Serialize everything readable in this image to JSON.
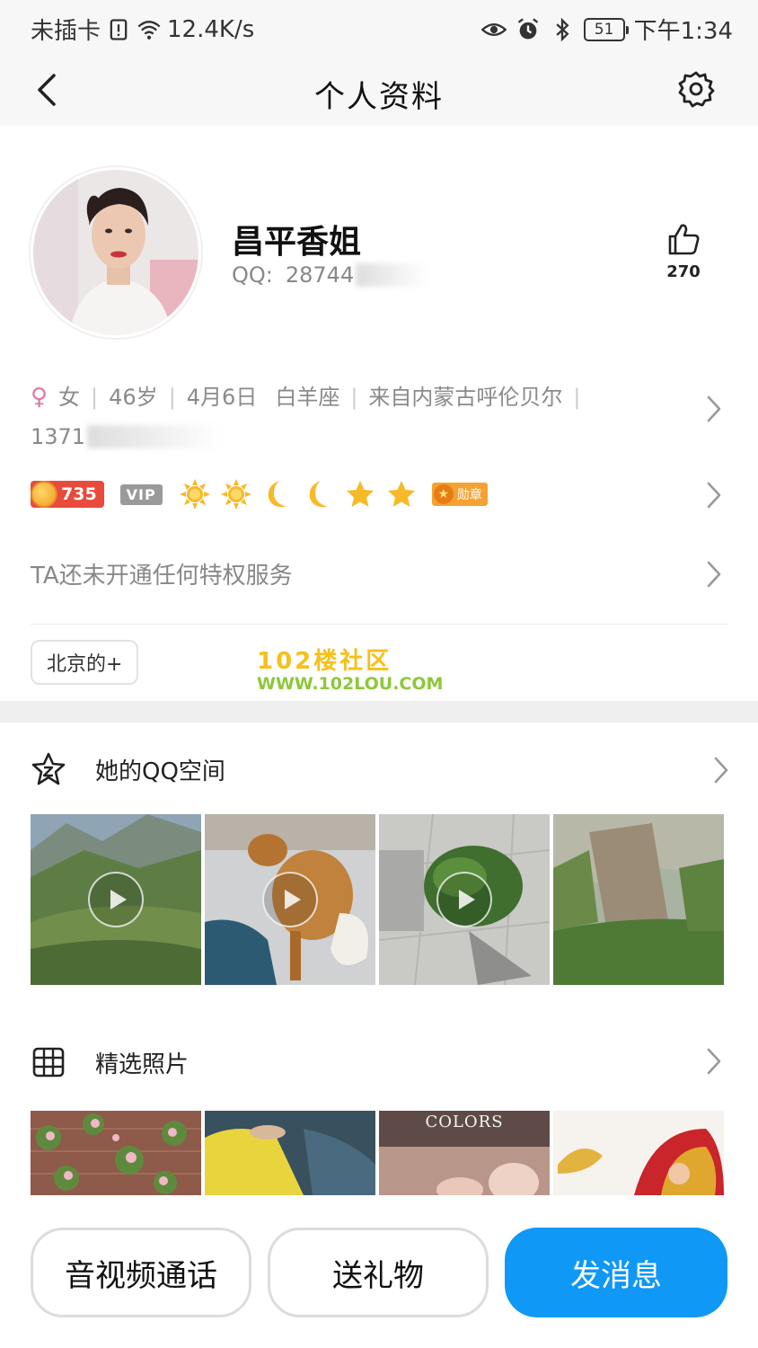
{
  "status_bar": {
    "carrier": "未插卡",
    "speed": "12.4K/s",
    "battery": "51",
    "time": "下午1:34"
  },
  "nav": {
    "title": "个人资料",
    "back_icon": "chevron-left-icon",
    "settings_icon": "gear-icon"
  },
  "profile": {
    "name": "昌平香姐",
    "qq_label": "QQ:",
    "qq_value": "28744",
    "likes": "270"
  },
  "info": {
    "gender": "女",
    "age": "46岁",
    "birthday": "4月6日",
    "zodiac": "白羊座",
    "hometown": "来自内蒙古呼伦贝尔",
    "phone": "1371"
  },
  "badges": {
    "level": "735",
    "vip": "VIP",
    "medal": "勋章"
  },
  "privilege_text": "TA还未开通任何特权服务",
  "tag": "北京的+",
  "watermark": {
    "line1": "102楼社区",
    "line2": "WWW.102LOU.COM"
  },
  "qzone": {
    "title": "她的QQ空间"
  },
  "photos": {
    "title": "精选照片",
    "third_caption": "COLORS"
  },
  "actions": {
    "call": "音视频通话",
    "gift": "送礼物",
    "message": "发消息"
  },
  "colors": {
    "primary": "#0f98f5",
    "female": "#e277a7",
    "level": "#e84a3b"
  }
}
